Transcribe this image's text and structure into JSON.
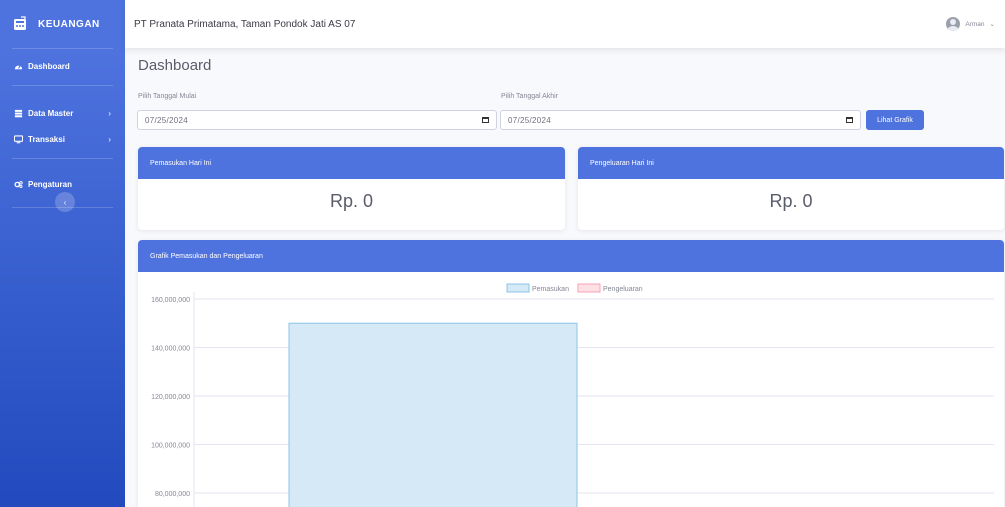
{
  "sidebar": {
    "brand": "KEUANGAN",
    "items": [
      {
        "label": "Dashboard",
        "icon": "tachometer-icon"
      },
      {
        "label": "Data Master",
        "icon": "database-icon",
        "has_children": true
      },
      {
        "label": "Transaksi",
        "icon": "desktop-icon",
        "has_children": true
      },
      {
        "label": "Pengaturan",
        "icon": "cogs-icon"
      }
    ],
    "toggle_glyph": "‹"
  },
  "topbar": {
    "organization": "PT Pranata Primatama, Taman Pondok Jati AS 07",
    "user_name": "Arman",
    "user_chevron": "⌄"
  },
  "main": {
    "page_title": "Dashboard",
    "filter": {
      "start_label": "Pilih Tanggal Mulai",
      "start_value": "07/25/2024",
      "end_label": "Pilih Tanggal Akhir",
      "end_value": "07/25/2024",
      "submit_label": "Lihat Grafik"
    },
    "cards": {
      "income": {
        "title": "Pemasukan Hari Ini",
        "value": "Rp. 0"
      },
      "expense": {
        "title": "Pengeluaran Hari Ini",
        "value": "Rp. 0"
      }
    },
    "chart_card": {
      "title": "Grafik Pemasukan dan Pengeluaran"
    }
  },
  "colors": {
    "primary": "#4e73df",
    "income_fill": "#d6e9f7",
    "income_stroke": "#8cc3ea",
    "expense_fill": "#fde0e4",
    "expense_stroke": "#f5a3b3"
  },
  "chart_data": {
    "type": "bar",
    "title": "",
    "series": [
      {
        "name": "Pemasukan",
        "values": [
          150000000
        ]
      },
      {
        "name": "Pengeluaran",
        "values": [
          0
        ]
      }
    ],
    "y_ticks": [
      "160,000,000",
      "140,000,000",
      "120,000,000",
      "100,000,000",
      "80,000,000"
    ],
    "y_tick_values": [
      160000000,
      140000000,
      120000000,
      100000000,
      80000000
    ],
    "ylim_visible": [
      80000000,
      160000000
    ],
    "legend_position": "top",
    "grid": true
  }
}
